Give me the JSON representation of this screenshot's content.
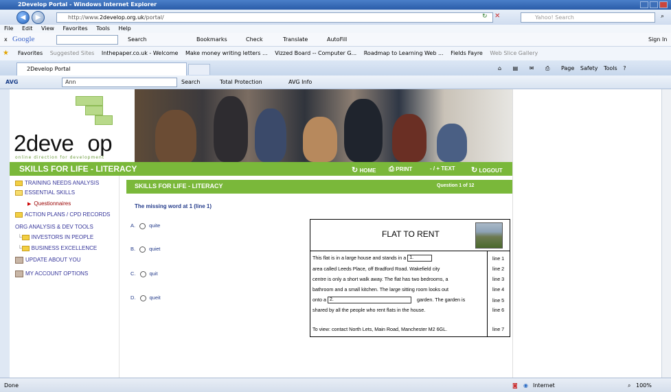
{
  "window": {
    "title": "2Develop Portal - Windows Internet Explorer"
  },
  "addressbar": {
    "url_prefix": "http://www.",
    "url_domain": "2develop.org.uk",
    "url_suffix": "/portal/",
    "search_placeholder": "Yahoo! Search"
  },
  "menu": [
    "File",
    "Edit",
    "View",
    "Favorites",
    "Tools",
    "Help"
  ],
  "googlebar": {
    "close": "x",
    "brand": "Google",
    "items": [
      "Search",
      "Bookmarks",
      "Check",
      "Translate",
      "AutoFill"
    ],
    "sign_in": "Sign In"
  },
  "favorites": {
    "label": "Favorites",
    "items": [
      "Suggested Sites",
      "Inthepaper.co.uk - Welcome",
      "Make money writing letters ...",
      "Vizzed Board -- Computer G...",
      "Roadmap to Learning Web ...",
      "Fields Fayre",
      "Web Slice Gallery"
    ]
  },
  "tabs": {
    "active": "2Develop Portal",
    "commands": [
      "Page",
      "Safety",
      "Tools"
    ]
  },
  "avgbar": {
    "brand": "AVG",
    "search_value": "Ann",
    "search_label": "Search",
    "total_protection": "Total Protection",
    "info": "AVG Info"
  },
  "site": {
    "logo_left": "2deve",
    "logo_right": "op",
    "tagline": "online direction for development",
    "section_title": "SKILLS FOR LIFE - LITERACY",
    "nav": {
      "home": "HOME",
      "print": "PRINT",
      "text": "- / + TEXT",
      "logout": "LOGOUT"
    }
  },
  "sidebar": {
    "items": [
      {
        "label": "TRAINING NEEDS ANALYSIS"
      },
      {
        "label": "ESSENTIAL SKILLS"
      },
      {
        "label": "Questionnaires"
      },
      {
        "label": "ACTION PLANS / CPD RECORDS"
      },
      {
        "label": "ORG ANALYSIS & DEV TOOLS"
      },
      {
        "label": "INVESTORS IN PEOPLE"
      },
      {
        "label": "BUSINESS EXCELLENCE"
      },
      {
        "label": "UPDATE ABOUT YOU"
      },
      {
        "label": "MY ACCOUNT OPTIONS"
      }
    ]
  },
  "question": {
    "header": "SKILLS FOR LIFE - LITERACY",
    "counter": "Question 1 of 12",
    "prompt": "The missing word at 1 (line 1)",
    "options": [
      {
        "letter": "A.",
        "text": "quite"
      },
      {
        "letter": "B.",
        "text": "quiet"
      },
      {
        "letter": "C.",
        "text": "quit"
      },
      {
        "letter": "D.",
        "text": "queit"
      }
    ]
  },
  "flat": {
    "title": "FLAT TO RENT",
    "lines": [
      {
        "pre": "This flat is in a large house and stands in a",
        "blank": "1.",
        "post": "",
        "num": "line 1"
      },
      {
        "pre": "area called Leeds Place, off Bradford Road. Wakefield city",
        "num": "line 2"
      },
      {
        "pre": "centre is only a short walk away. The flat has two bedrooms, a",
        "num": "line 3"
      },
      {
        "pre": "bathroom and a small kitchen. The large sitting room looks out",
        "num": "line 4"
      },
      {
        "pre": "onto a",
        "blank": "2.",
        "post": "garden. The garden is",
        "num": "line 5"
      },
      {
        "pre": "shared by all the people who rent flats in the house.",
        "num": "line 6"
      },
      {
        "pre": "To view: contact North Lets, Main Road, Manchester M2 6GL.",
        "num": "line 7"
      }
    ]
  },
  "status": {
    "left": "Done",
    "zone": "Internet",
    "zoom": "100%"
  }
}
